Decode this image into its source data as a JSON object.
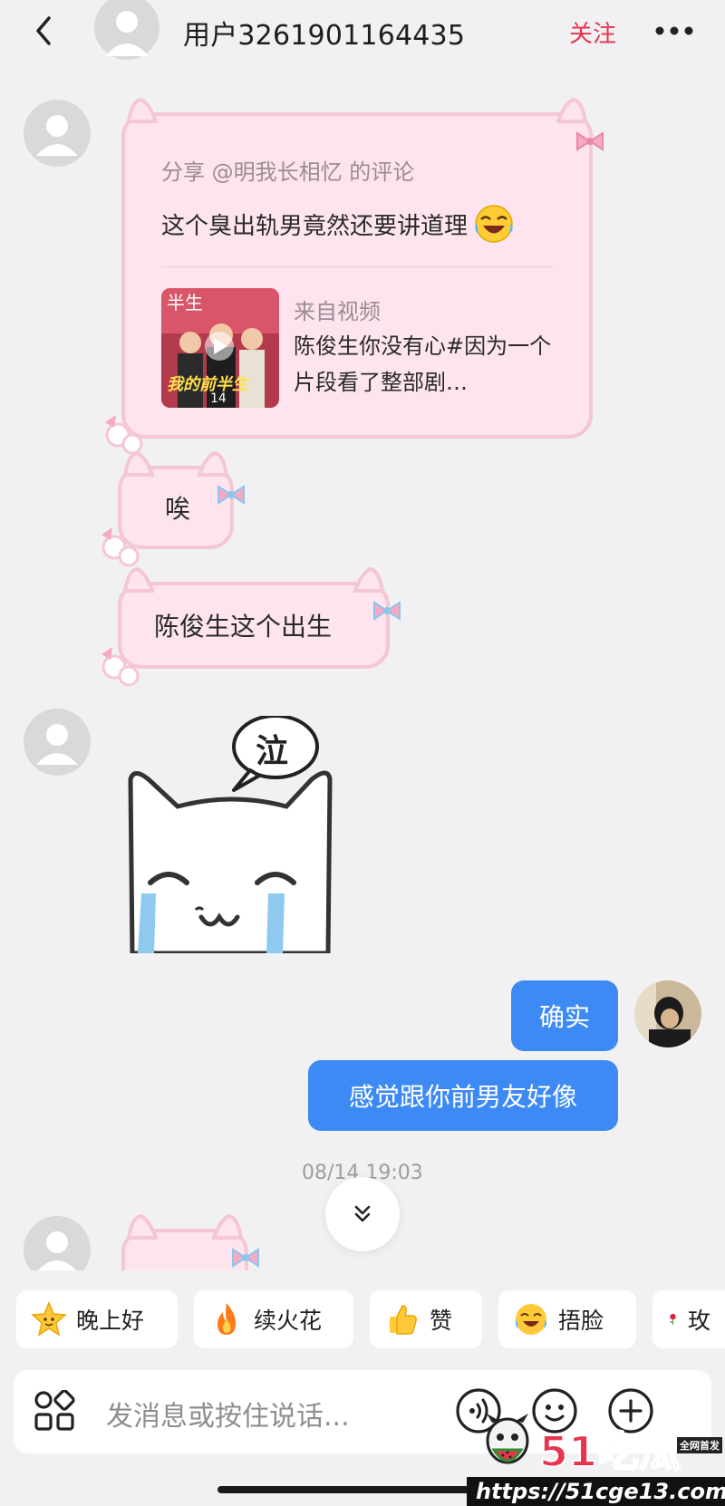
{
  "header": {
    "title": "用户3261901164435",
    "follow_label": "关注"
  },
  "messages": {
    "share": {
      "label": "分享 @明我长相忆 的评论",
      "text": "这个臭出轨男竟然还要讲道理",
      "from_label": "来自视频",
      "video_title": "陈俊生你没有心#因为一个片段看了整部剧…",
      "thumb_caption": "我的前半生",
      "thumb_top_text": "半生",
      "thumb_number": "14"
    },
    "msg1": "唉",
    "msg2": "陈俊生这个出生",
    "sticker_text": "泣",
    "mine1": "确实",
    "mine2": "感觉跟你前男友好像",
    "timestamp": "08/14 19:03"
  },
  "quick_replies": [
    {
      "label": "晚上好",
      "icon": "star-face-icon"
    },
    {
      "label": "续火花",
      "icon": "fire-icon"
    },
    {
      "label": "赞",
      "icon": "thumbs-up-icon"
    },
    {
      "label": "捂脸",
      "icon": "facepalm-icon"
    },
    {
      "label": "玫",
      "icon": "rose-icon"
    }
  ],
  "input": {
    "placeholder": "发消息或按住说话..."
  },
  "watermark": {
    "brand": "51吃瓜",
    "tag": "全网首发",
    "url": "https://51cge13.com"
  },
  "colors": {
    "accent_red": "#e8344f",
    "bubble_blue": "#3d8af5",
    "kitty_pink": "#fde4ee"
  }
}
